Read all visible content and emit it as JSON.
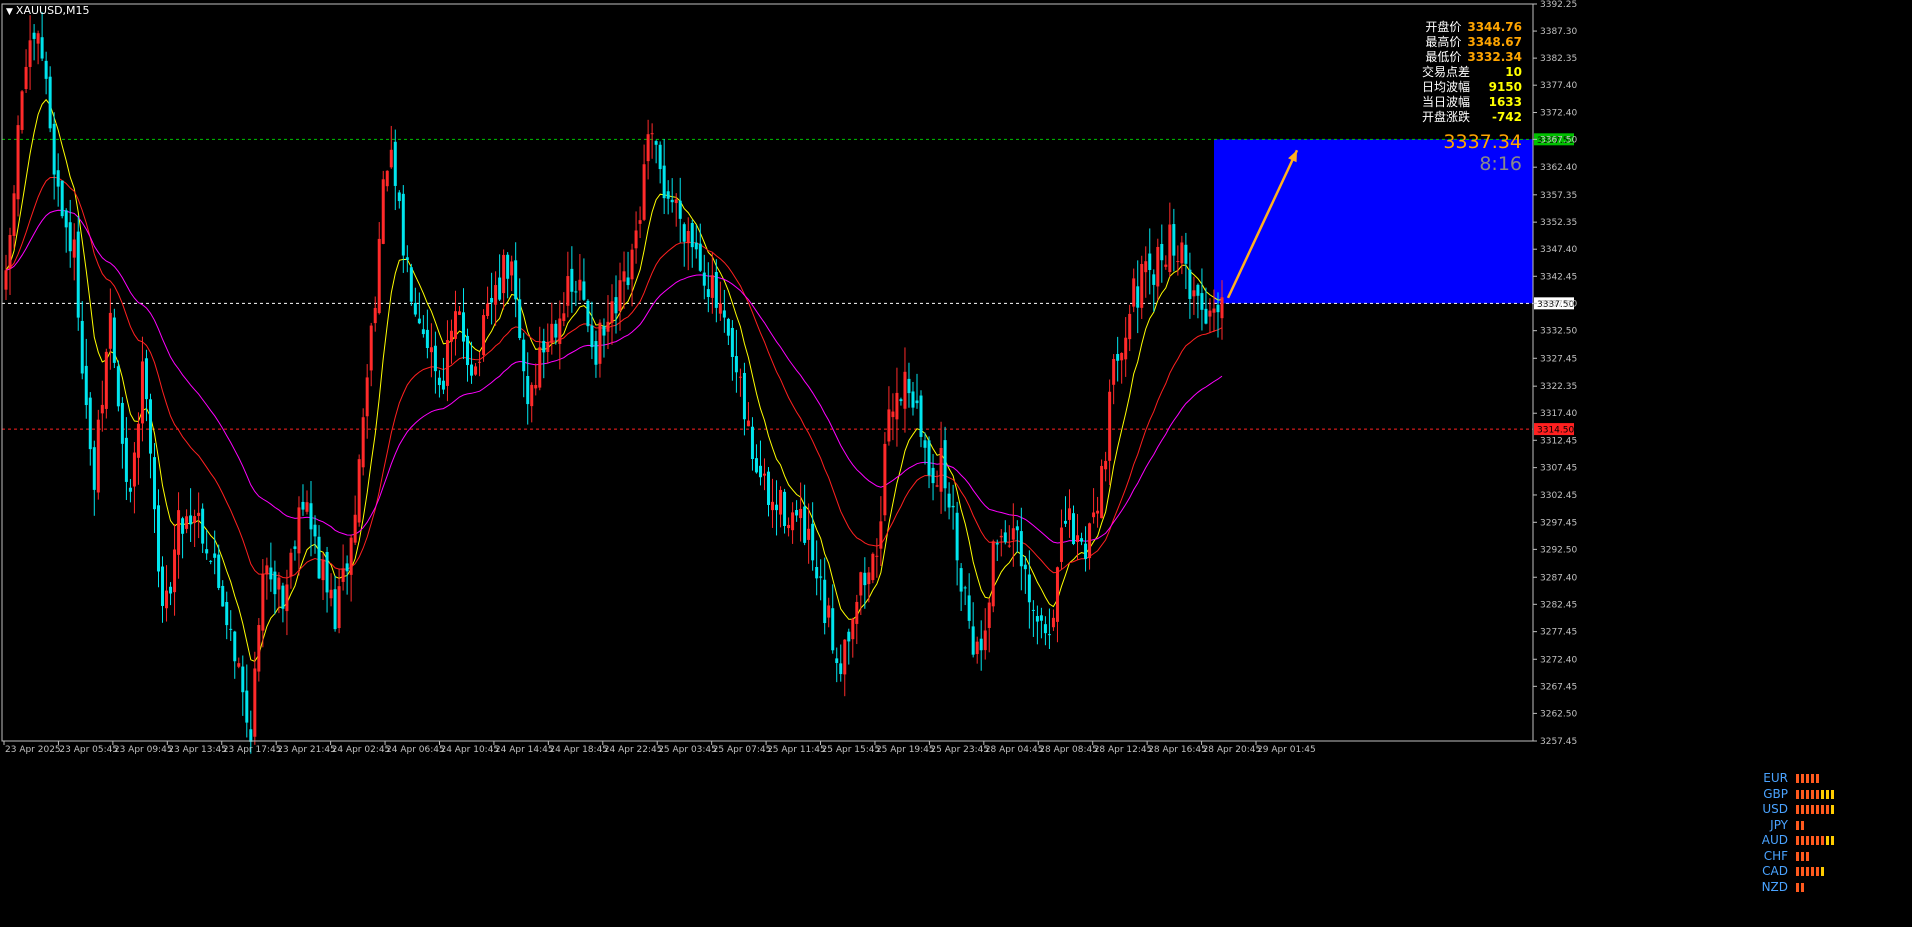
{
  "window": {
    "symbol_title": "XAUUSD,M15"
  },
  "colors": {
    "background": "#000000",
    "bull_candle": "#ff2a2a",
    "bear_candle": "#00e5ee",
    "ma_fast": "#ffff00",
    "ma_mid": "#ff2020",
    "ma_slow": "#ff00ff",
    "zone_fill": "#0000ff",
    "arrow": "#ffb020",
    "resistance_line": "#00c000",
    "support_line": "#ff2020",
    "current_line": "#ffffff"
  },
  "info_panel": [
    {
      "label": "开盘价",
      "value": "3344.76",
      "color": "orange"
    },
    {
      "label": "最高价",
      "value": "3348.67",
      "color": "orange"
    },
    {
      "label": "最低价",
      "value": "3332.34",
      "color": "orange"
    },
    {
      "label": "交易点差",
      "value": "10",
      "color": "yellow"
    },
    {
      "label": "日均波幅",
      "value": "9150",
      "color": "yellow"
    },
    {
      "label": "当日波幅",
      "value": "1633",
      "color": "yellow"
    },
    {
      "label": "开盘涨跌",
      "value": "-742",
      "color": "yellow"
    }
  ],
  "current_price": "3337.34",
  "bar_timer": "8:16",
  "currency_strength": [
    {
      "name": "EUR",
      "bars": 5,
      "yellow": 0
    },
    {
      "name": "GBP",
      "bars": 8,
      "yellow": 3
    },
    {
      "name": "USD",
      "bars": 8,
      "yellow": 1
    },
    {
      "name": "JPY",
      "bars": 2,
      "yellow": 0
    },
    {
      "name": "AUD",
      "bars": 8,
      "yellow": 2
    },
    {
      "name": "CHF",
      "bars": 3,
      "yellow": 0
    },
    {
      "name": "CAD",
      "bars": 6,
      "yellow": 1
    },
    {
      "name": "NZD",
      "bars": 2,
      "yellow": 0
    }
  ],
  "chart_data": {
    "type": "candlestick",
    "symbol": "XAUUSD",
    "timeframe": "M15",
    "ylim": [
      3257.45,
      3392.25
    ],
    "y_ticks": [
      "3392.25",
      "3387.30",
      "3382.35",
      "3377.40",
      "3372.40",
      "3367.50",
      "3362.40",
      "3357.35",
      "3352.35",
      "3347.40",
      "3342.45",
      "3337.50",
      "3332.50",
      "3327.45",
      "3322.35",
      "3317.40",
      "3312.45",
      "3307.45",
      "3302.45",
      "3297.45",
      "3292.50",
      "3287.40",
      "3282.45",
      "3277.45",
      "3272.40",
      "3267.45",
      "3262.50",
      "3257.45"
    ],
    "x_ticks": [
      "23 Apr 2025",
      "23 Apr 05:45",
      "23 Apr 09:45",
      "23 Apr 13:45",
      "23 Apr 17:45",
      "23 Apr 21:45",
      "24 Apr 02:45",
      "24 Apr 06:45",
      "24 Apr 10:45",
      "24 Apr 14:45",
      "24 Apr 18:45",
      "24 Apr 22:45",
      "25 Apr 03:45",
      "25 Apr 07:45",
      "25 Apr 11:45",
      "25 Apr 15:45",
      "25 Apr 19:45",
      "25 Apr 23:45",
      "28 Apr 04:45",
      "28 Apr 08:45",
      "28 Apr 12:45",
      "28 Apr 16:45",
      "28 Apr 20:45",
      "29 Apr 01:45"
    ],
    "horizontal_lines": [
      {
        "price": 3367.5,
        "label": "3367.50",
        "color": "#00c000"
      },
      {
        "price": 3337.5,
        "label": "3337.50",
        "color": "#ffffff"
      },
      {
        "price": 3314.5,
        "label": "3314.50",
        "color": "#ff2020"
      }
    ],
    "target_zone": {
      "top": 3367.5,
      "bottom": 3337.5
    },
    "arrow": {
      "from_price": 3338.5,
      "to_price": 3365.5
    },
    "price_path": [
      3340,
      3380,
      3385,
      3358,
      3345,
      3302,
      3335,
      3300,
      3328,
      3279,
      3298,
      3300,
      3289,
      3278,
      3258,
      3292,
      3283,
      3304,
      3290,
      3280,
      3296,
      3332,
      3366,
      3345,
      3335,
      3323,
      3335,
      3325,
      3338,
      3345,
      3320,
      3330,
      3338,
      3340,
      3329,
      3335,
      3343,
      3367,
      3358,
      3353,
      3346,
      3336,
      3324,
      3310,
      3300,
      3300,
      3295,
      3282,
      3272,
      3285,
      3290,
      3320,
      3324,
      3308,
      3307,
      3288,
      3272,
      3295,
      3296,
      3280,
      3277,
      3298,
      3292,
      3305,
      3330,
      3340,
      3342,
      3350,
      3343,
      3335,
      3340
    ]
  }
}
